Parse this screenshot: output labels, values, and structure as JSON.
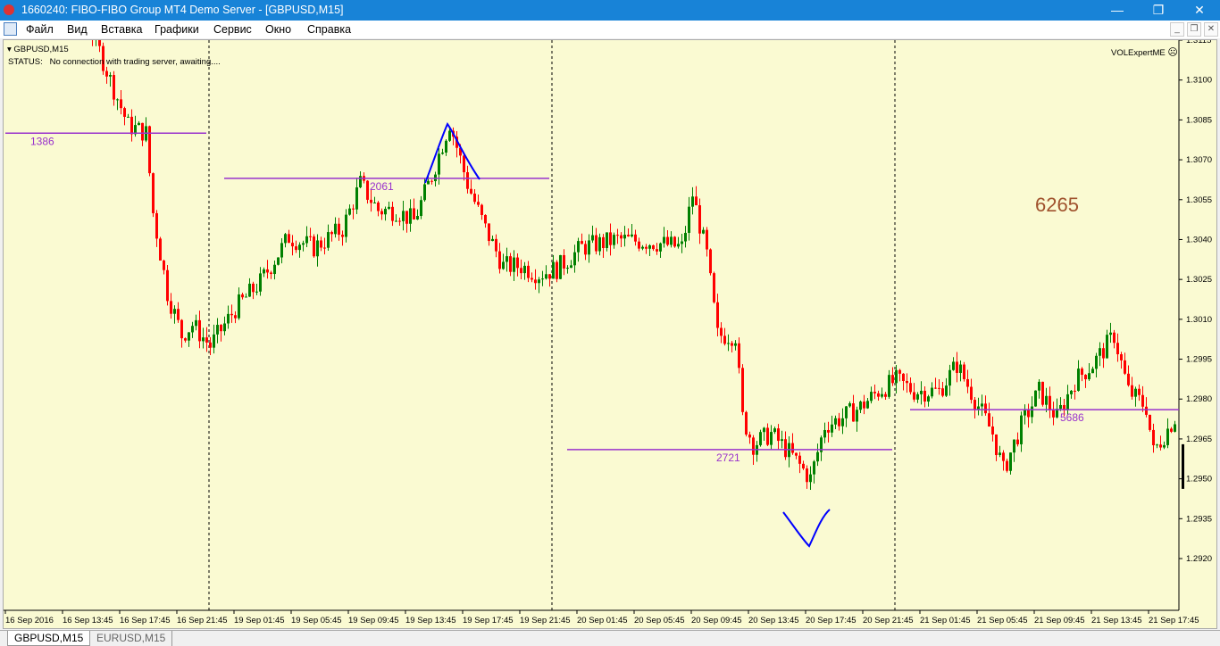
{
  "window": {
    "title": "1660240: FIBO-FIBO Group MT4 Demo Server - [GBPUSD,M15]",
    "minimize": "—",
    "restore": "❐",
    "close": "✕"
  },
  "menu": [
    "Файл",
    "Вид",
    "Вставка",
    "Графики",
    "Сервис",
    "Окно",
    "Справка"
  ],
  "mdi": {
    "minimize": "_",
    "restore": "❐",
    "close": "✕"
  },
  "chart": {
    "symbol": "GBPUSD,M15",
    "status_label": "STATUS:",
    "status_text": "No connection with trading server, awaiting....",
    "expert": "VOLExpertME",
    "expert_icon": "sad-face-icon",
    "big_number": "6265",
    "big_number_color": "#a0522d"
  },
  "tabs": [
    "GBPUSD,M15",
    "EURUSD,M15"
  ],
  "chart_data": {
    "type": "candlestick",
    "symbol": "GBPUSD",
    "timeframe": "M15",
    "ylim": [
      1.2912,
      1.3128
    ],
    "yticks": [
      "1.3115",
      "1.3100",
      "1.3085",
      "1.3070",
      "1.3055",
      "1.3040",
      "1.3025",
      "1.3010",
      "1.2995",
      "1.2980",
      "1.2965",
      "1.2950",
      "1.2935",
      "1.2920"
    ],
    "xticks": [
      "16 Sep 2016",
      "16 Sep 13:45",
      "16 Sep 17:45",
      "16 Sep 21:45",
      "19 Sep 01:45",
      "19 Sep 05:45",
      "19 Sep 09:45",
      "19 Sep 13:45",
      "19 Sep 17:45",
      "19 Sep 21:45",
      "20 Sep 01:45",
      "20 Sep 05:45",
      "20 Sep 09:45",
      "20 Sep 13:45",
      "20 Sep 17:45",
      "20 Sep 21:45",
      "21 Sep 01:45",
      "21 Sep 05:45",
      "21 Sep 09:45",
      "21 Sep 13:45",
      "21 Sep 17:45"
    ],
    "candle_count": 328,
    "close_anchors": [
      [
        0,
        1.313
      ],
      [
        24,
        1.3118
      ],
      [
        29,
        1.31
      ],
      [
        34,
        1.3083
      ],
      [
        39,
        1.308
      ],
      [
        41,
        1.305
      ],
      [
        45,
        1.302
      ],
      [
        49,
        1.3004
      ],
      [
        52,
        1.3008
      ],
      [
        57,
        1.3
      ],
      [
        64,
        1.3014
      ],
      [
        71,
        1.3024
      ],
      [
        79,
        1.3041
      ],
      [
        86,
        1.3037
      ],
      [
        94,
        1.3044
      ],
      [
        99,
        1.3061
      ],
      [
        104,
        1.3051
      ],
      [
        109,
        1.3051
      ],
      [
        114,
        1.3047
      ],
      [
        119,
        1.3064
      ],
      [
        124,
        1.3084
      ],
      [
        129,
        1.3061
      ],
      [
        134,
        1.3044
      ],
      [
        139,
        1.303
      ],
      [
        144,
        1.303
      ],
      [
        149,
        1.3027
      ],
      [
        154,
        1.3029
      ],
      [
        161,
        1.3037
      ],
      [
        171,
        1.304
      ],
      [
        181,
        1.3039
      ],
      [
        189,
        1.3037
      ],
      [
        192,
        1.3057
      ],
      [
        196,
        1.3034
      ],
      [
        199,
        1.3004
      ],
      [
        204,
        1.3004
      ],
      [
        206,
        1.2973
      ],
      [
        209,
        1.2963
      ],
      [
        214,
        1.2967
      ],
      [
        219,
        1.296
      ],
      [
        225,
        1.295
      ],
      [
        229,
        1.297
      ],
      [
        234,
        1.2973
      ],
      [
        239,
        1.2977
      ],
      [
        244,
        1.2983
      ],
      [
        249,
        1.2987
      ],
      [
        254,
        1.2983
      ],
      [
        261,
        1.2983
      ],
      [
        266,
        1.2993
      ],
      [
        271,
        1.298
      ],
      [
        276,
        1.2967
      ],
      [
        279,
        1.2953
      ],
      [
        284,
        1.297
      ],
      [
        289,
        1.2983
      ],
      [
        294,
        1.2973
      ],
      [
        299,
        1.2987
      ],
      [
        304,
        1.2993
      ],
      [
        310,
        1.3004
      ],
      [
        314,
        1.2983
      ],
      [
        319,
        1.2977
      ],
      [
        321,
        1.296
      ],
      [
        327,
        1.2973
      ]
    ],
    "levels": [
      {
        "label": "1386",
        "price": 1.308
      },
      {
        "label": "2061",
        "price": 1.3063
      },
      {
        "label": "2721",
        "price": 1.2961
      },
      {
        "label": "5686",
        "price": 1.2976
      }
    ],
    "colors": {
      "bull": "#008000",
      "bear": "#ff0000",
      "level": "#9932cc",
      "drawing": "#0000ff",
      "background": "#fafad2"
    }
  }
}
